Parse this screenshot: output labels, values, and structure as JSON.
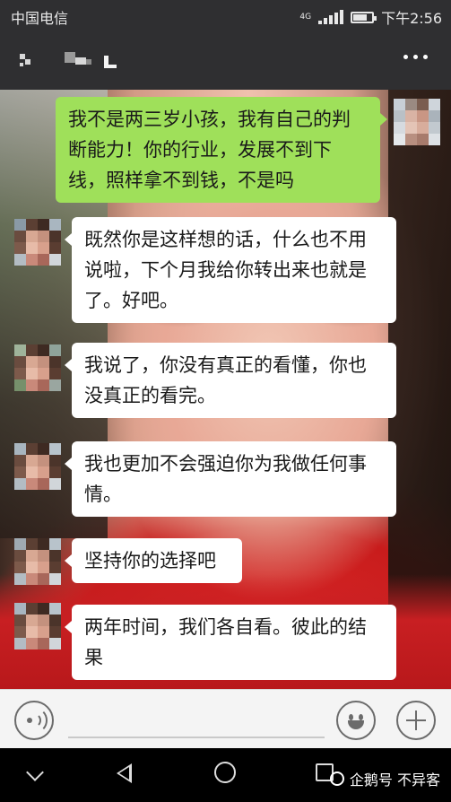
{
  "status_bar": {
    "carrier": "中国电信",
    "network": "4G",
    "time": "下午2:56"
  },
  "title_bar": {
    "more_icon": "more-dots-icon"
  },
  "messages": [
    {
      "side": "out",
      "text": "我不是两三岁小孩，我有自己的判断能力！你的行业，发展不到下线，照样拿不到钱，不是吗"
    },
    {
      "side": "in",
      "text": "既然你是这样想的话，什么也不用说啦，下个月我给你转出来也就是了。好吧。"
    },
    {
      "side": "in",
      "text": "我说了，你没有真正的看懂，你也没真正的看完。"
    },
    {
      "side": "in",
      "text": "我也更加不会强迫你为我做任何事情。"
    },
    {
      "side": "in",
      "text": "坚持你的选择吧"
    },
    {
      "side": "in",
      "text": "两年时间，我们各自看。彼此的结果"
    }
  ],
  "input_bar": {
    "voice_icon": "voice-icon",
    "emoji_icon": "emoji-icon",
    "plus_icon": "plus-icon"
  },
  "watermark": {
    "text": "企鹅号 不异客"
  },
  "colors": {
    "outgoing_bubble": "#9fe05a",
    "incoming_bubble": "#ffffff",
    "header": "#2f2f31"
  }
}
